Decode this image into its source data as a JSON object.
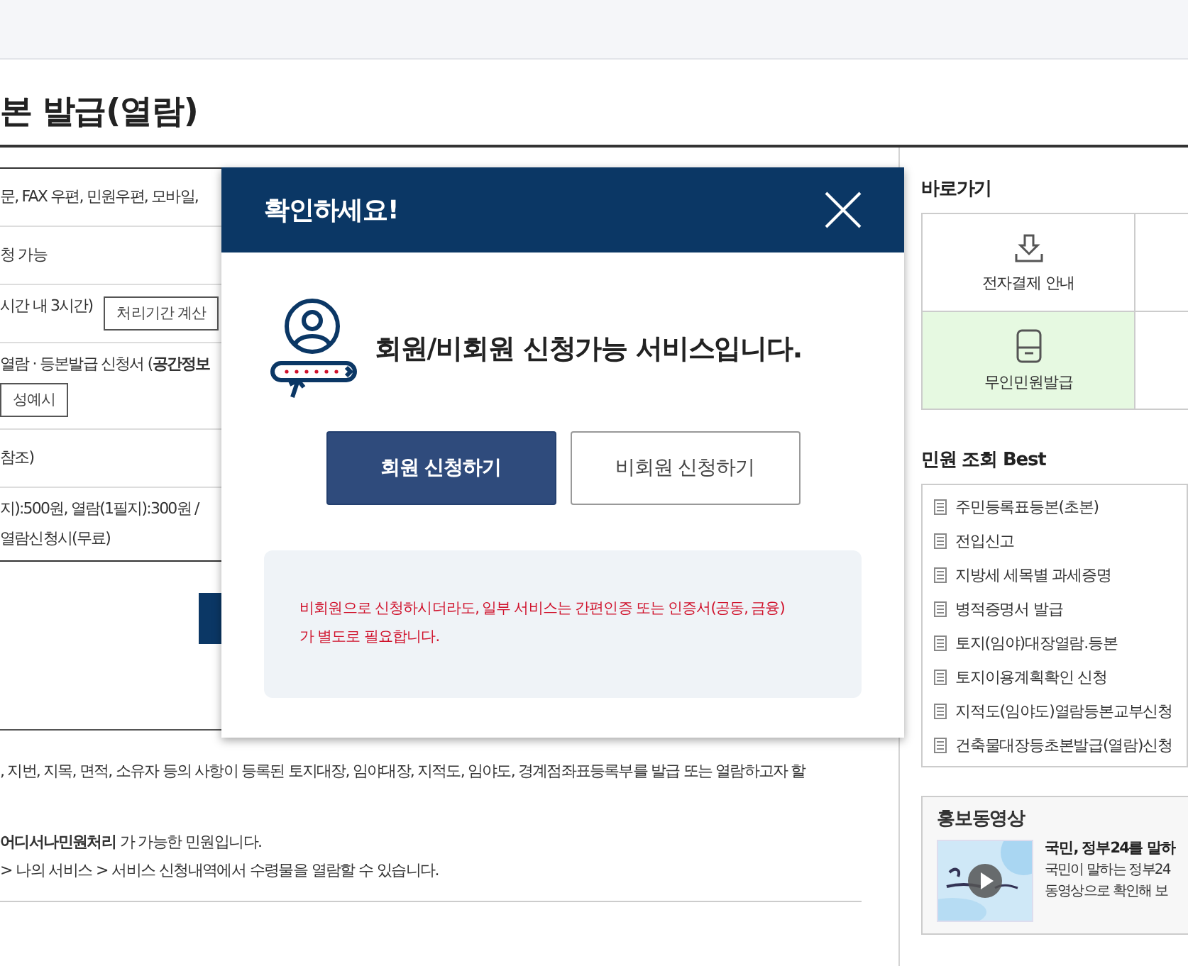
{
  "page": {
    "title": "본 발급(열람)"
  },
  "info_rows": [
    {
      "kind": "text",
      "lines": [
        "문, FAX 우편, 민원우편, 모바일,"
      ]
    },
    {
      "kind": "text",
      "lines": [
        "청 가능"
      ]
    },
    {
      "kind": "text_button",
      "lines": [
        "시간 내 3시간)"
      ],
      "button": "처리기간 계산"
    },
    {
      "kind": "text_button_below",
      "lines": [
        "열람 · 등본발급 신청서 (**공간정보**"
      ],
      "button": "성예시"
    },
    {
      "kind": "text",
      "lines": [
        "참조)"
      ]
    },
    {
      "kind": "text",
      "lines": [
        "지):500원, 열람(1필지):300원 /",
        "열람신청시(무료)"
      ]
    }
  ],
  "description": [
    ", 지번, 지목, 면적, 소유자 등의 사항이 등록된 토지대장, 임야대장, 지적도, 임야도, 경계점좌표등록부를 발급 또는 열람하고자 할"
  ],
  "notes": [
    "**어디서나민원처리** 가 가능한 민원입니다.",
    "> 나의 서비스 > 서비스 신청내역에서 수령물을 열람할 수 있습니다."
  ],
  "modal": {
    "title": "확인하세요!",
    "headline": "회원/비회원 신청가능 서비스입니다.",
    "buttons": [
      {
        "label": "회원 신청하기",
        "primary": true
      },
      {
        "label": "비회원 신청하기",
        "primary": false
      }
    ],
    "notice": [
      "비회원으로 신청하시더라도, 일부 서비스는 간편인증 또는 인증서(공동, 금융)",
      "가 별도로 필요합니다."
    ]
  },
  "sidebar": {
    "quick_title": "바로가기",
    "quick_links": [
      {
        "label": "전자결제 안내",
        "kind": "download",
        "highlighted": false
      },
      {
        "label": "무인민원발급",
        "kind": "kiosk",
        "highlighted": true
      }
    ],
    "best_title": "민원 조회 Best",
    "best_items": [
      "주민등록표등본(초본)",
      "전입신고",
      "지방세 세목별 과세증명",
      "병적증명서 발급",
      "토지(임야)대장열람.등본",
      "토지이용계획확인 신청",
      "지적도(임야도)열람등본교부신청",
      "건축물대장등초본발급(열람)신청"
    ],
    "video_title": "홍보동영상",
    "video": {
      "kind": "picture",
      "title": "국민, 정부24를 말하",
      "lines": [
        "국민이 말하는 정부24",
        "동영상으로 확인해 보"
      ]
    }
  }
}
